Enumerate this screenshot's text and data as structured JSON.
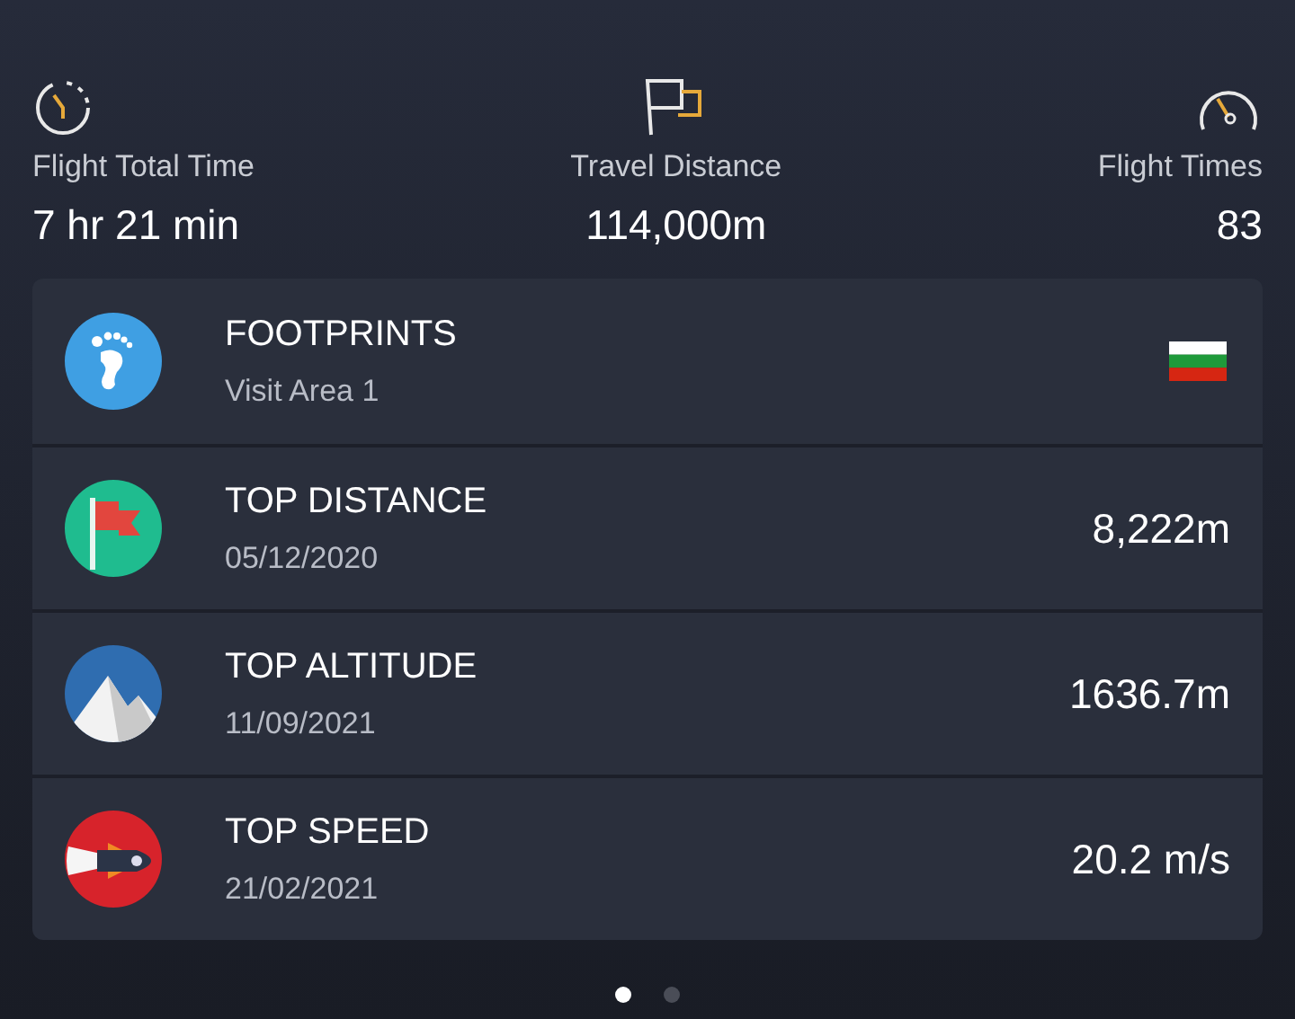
{
  "stats": [
    {
      "kind": "timer",
      "label": "Flight Total Time",
      "value": "7 hr 21 min"
    },
    {
      "kind": "distance",
      "label": "Travel Distance",
      "value": "114,000m"
    },
    {
      "kind": "gauge",
      "label": "Flight Times",
      "value": "83"
    }
  ],
  "records": [
    {
      "kind": "footprint",
      "title": "FOOTPRINTS",
      "subtitle": "Visit Area 1",
      "trailing": {
        "kind": "country-flag"
      }
    },
    {
      "kind": "flag",
      "title": "TOP DISTANCE",
      "subtitle": "05/12/2020",
      "trailing": {
        "kind": "text",
        "text": "8,222m"
      }
    },
    {
      "kind": "mountain",
      "title": "TOP ALTITUDE",
      "subtitle": "11/09/2021",
      "trailing": {
        "kind": "text",
        "text": "1636.7m"
      }
    },
    {
      "kind": "rocket",
      "title": "TOP SPEED",
      "subtitle": "21/02/2021",
      "trailing": {
        "kind": "text",
        "text": "20.2 m/s"
      }
    }
  ],
  "pager": [
    {
      "selected": true
    },
    {
      "selected": false
    }
  ]
}
